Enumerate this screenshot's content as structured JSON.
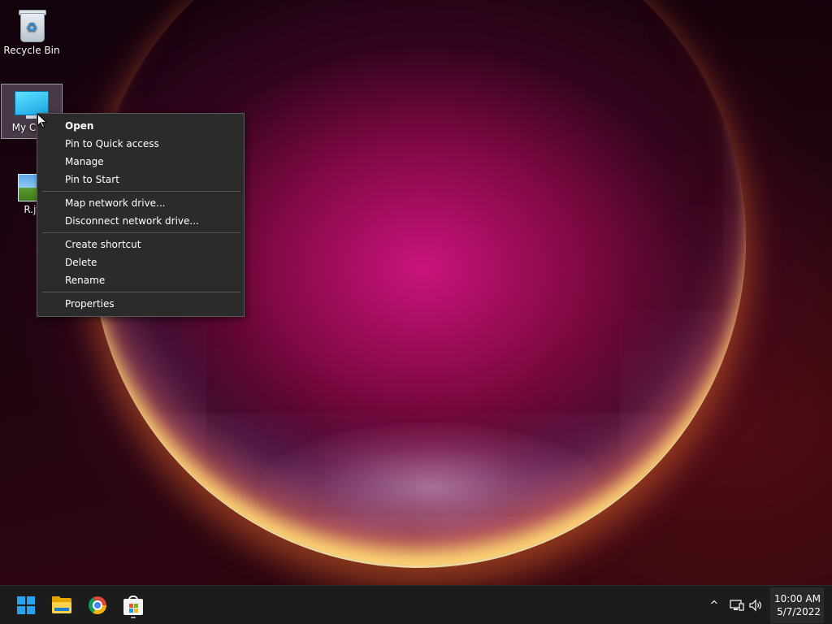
{
  "desktop": {
    "icons": [
      {
        "label": "Recycle Bin",
        "icon": "recycle-bin-icon"
      },
      {
        "label": "My Com",
        "icon": "computer-monitor-icon"
      },
      {
        "label": "R.jf",
        "icon": "image-file-icon"
      }
    ]
  },
  "context_menu": {
    "items": [
      {
        "label": "Open"
      },
      {
        "label": "Pin to Quick access"
      },
      {
        "label": "Manage"
      },
      {
        "label": "Pin to Start"
      },
      {
        "label": "Map network drive..."
      },
      {
        "label": "Disconnect network drive..."
      },
      {
        "label": "Create shortcut"
      },
      {
        "label": "Delete"
      },
      {
        "label": "Rename"
      },
      {
        "label": "Properties"
      }
    ]
  },
  "taskbar": {
    "apps": [
      {
        "icon": "windows-start-icon"
      },
      {
        "icon": "file-explorer-icon"
      },
      {
        "icon": "chrome-icon"
      },
      {
        "icon": "microsoft-store-icon"
      }
    ],
    "tray": {
      "chevron_glyph": "^",
      "time": "10:00 AM",
      "date": "5/7/2022"
    }
  },
  "colors": {
    "accent": "#29a3ef",
    "menu_bg": "#2b2b2b",
    "taskbar_bg": "#1c1c1c"
  }
}
